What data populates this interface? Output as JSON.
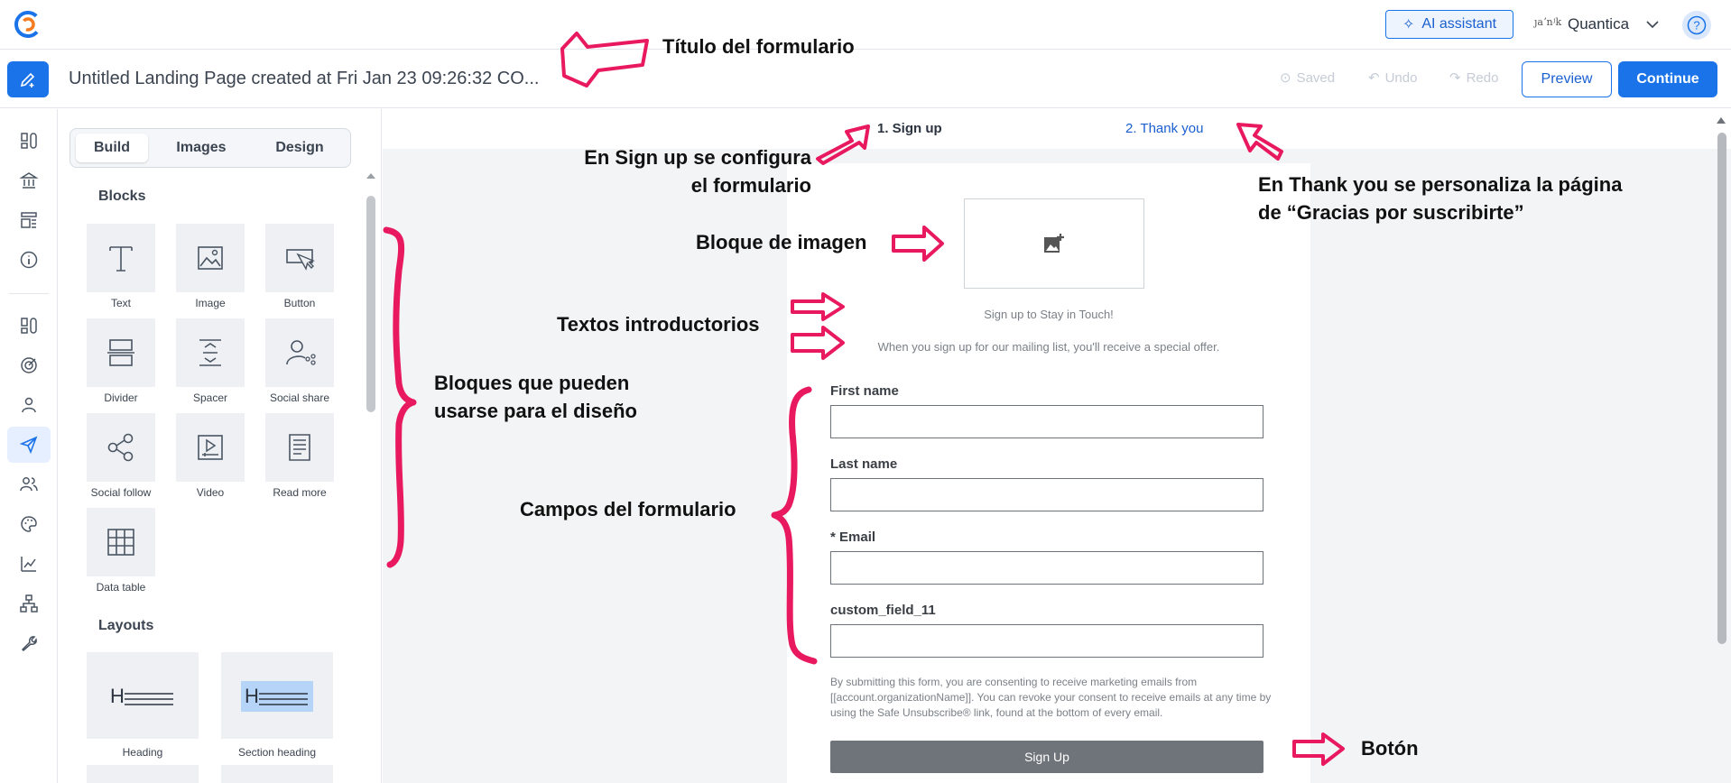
{
  "topbar": {
    "logo_icon": "constant-contact-logo-icon",
    "ai_assistant_label": "AI assistant",
    "org_logo_text": "ȷaʼnʲk",
    "org_name": "Quantica"
  },
  "header": {
    "page_title": "Untitled Landing Page created at Fri Jan 23 09:26:32 CO...",
    "saved_label": "Saved",
    "undo_label": "Undo",
    "redo_label": "Redo",
    "preview_label": "Preview",
    "continue_label": "Continue"
  },
  "panel": {
    "tabs": [
      "Build",
      "Images",
      "Design"
    ],
    "blocks_heading": "Blocks",
    "blocks": [
      "Text",
      "Image",
      "Button",
      "Divider",
      "Spacer",
      "Social share",
      "Social follow",
      "Video",
      "Read more",
      "Data table"
    ],
    "layouts_heading": "Layouts",
    "layouts": [
      "Heading",
      "Section heading"
    ]
  },
  "steps": {
    "step1": "1.  Sign up",
    "step2": "2.  Thank you"
  },
  "form": {
    "intro_title": "Sign up to Stay in Touch!",
    "intro_text": "When you sign up for our mailing list, you'll receive a special offer.",
    "fields": [
      "First name",
      "Last name",
      "* Email",
      "custom_field_11"
    ],
    "consent": "By submitting this form, you are consenting to receive marketing emails from [[account.organizationName]]. You can revoke your consent to receive emails at any time by using the Safe Unsubscribe® link, found at the bottom of every email.",
    "submit_label": "Sign Up"
  },
  "annotations": {
    "title": "Título del formulario",
    "signup_line1": "En Sign up se configura",
    "signup_line2": "el formulario",
    "thankyou_line1": "En Thank you se personaliza la página",
    "thankyou_line2": "de “Gracias por suscribirte”",
    "image_block": "Bloque de imagen",
    "intro_texts": "Textos introductorios",
    "blocks_line1": "Bloques que pueden",
    "blocks_line2": "usarse para el diseño",
    "fields": "Campos del formulario",
    "button": "Botón",
    "marker_color": "#e8195f"
  },
  "colors": {
    "accent": "#1a73e8",
    "marker": "#e8195f"
  }
}
